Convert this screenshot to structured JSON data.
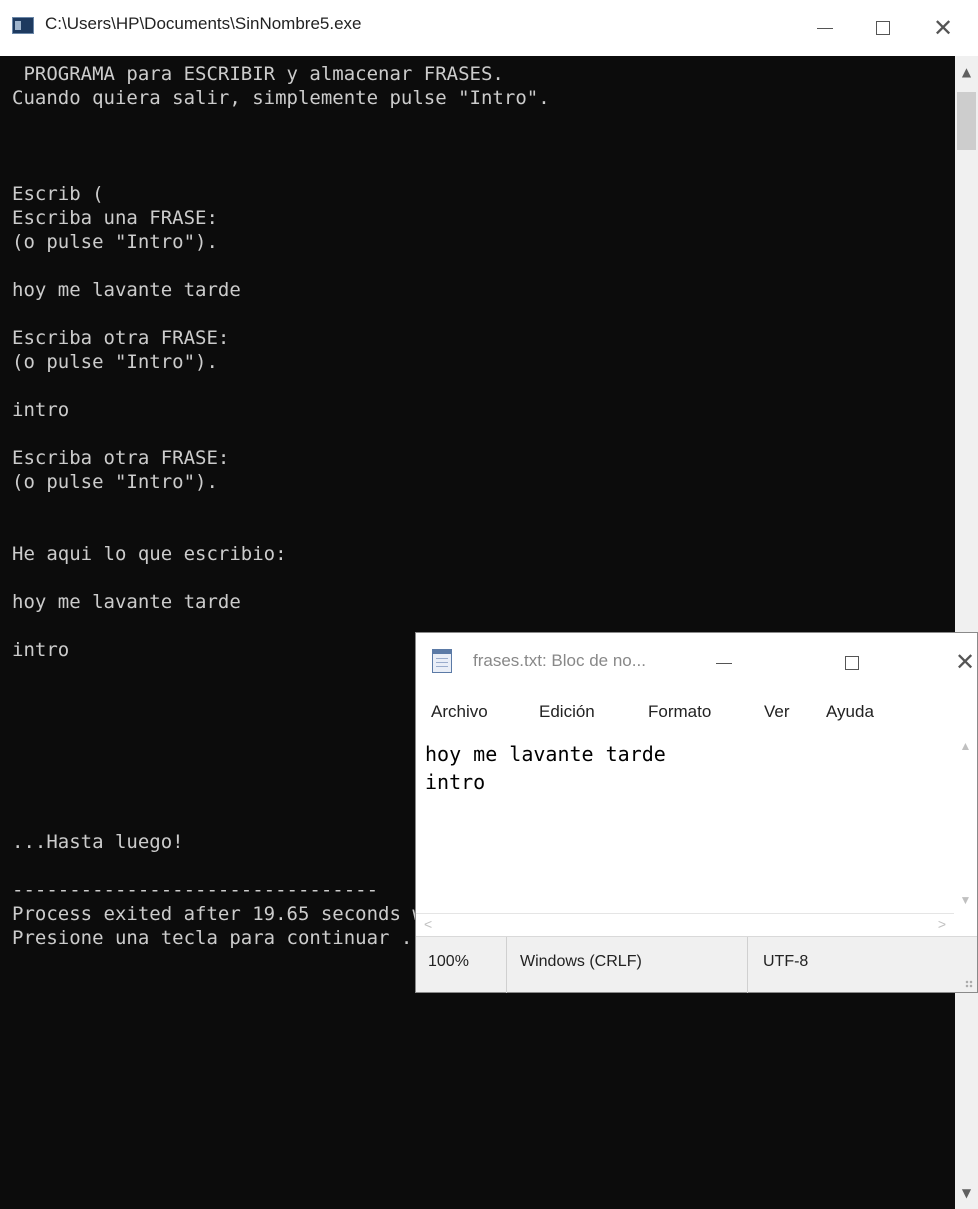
{
  "console": {
    "title": "C:\\Users\\HP\\Documents\\SinNombre5.exe",
    "output": " PROGRAMA para ESCRIBIR y almacenar FRASES.\nCuando quiera salir, simplemente pulse \"Intro\".\n\n\n\nEscrib (\nEscriba una FRASE:\n(o pulse \"Intro\").\n\nhoy me lavante tarde\n\nEscriba otra FRASE:\n(o pulse \"Intro\").\n\nintro\n\nEscriba otra FRASE:\n(o pulse \"Intro\").\n\n\nHe aqui lo que escribio:\n\nhoy me lavante tarde\n\nintro\n\n\n\n\n\n\n\n...Hasta luego!\n\n--------------------------------\nProcess exited after 19.65 seconds with return value 0\nPresione una tecla para continuar . . ."
  },
  "notepad": {
    "title": "frases.txt: Bloc de no...",
    "menu": [
      "Archivo",
      "Edición",
      "Formato",
      "Ver",
      "Ayuda"
    ],
    "content": "hoy me lavante tarde\nintro",
    "status": {
      "zoom": "100%",
      "line_ending": "Windows (CRLF)",
      "encoding": "UTF-8"
    }
  },
  "icons": {
    "console_app": "console-app-icon",
    "notepad_app": "notepad-icon",
    "minimize": "minimize-icon",
    "maximize": "maximize-icon",
    "close": "close-icon"
  },
  "colors": {
    "console_bg": "#0c0c0c",
    "console_text": "#cccccc",
    "window_chrome": "#ffffff",
    "status_bar": "#f0f0f0"
  }
}
